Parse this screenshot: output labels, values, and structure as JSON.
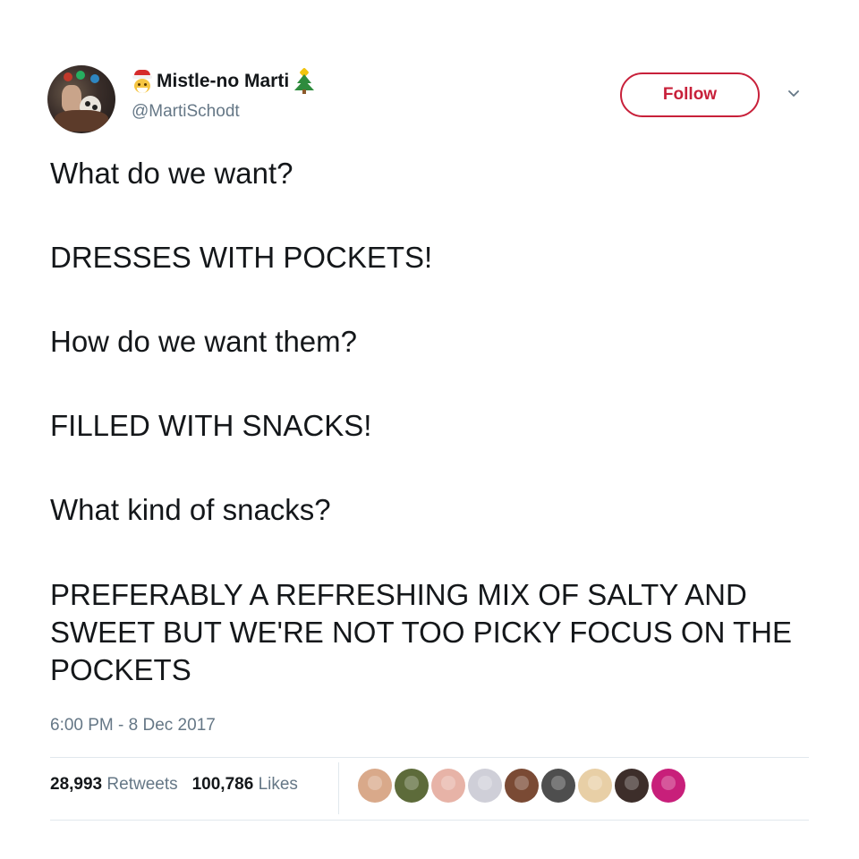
{
  "user": {
    "display_name": "Mistle-no Marti",
    "handle": "@MartiSchodt",
    "avatar_icon": "profile-photo",
    "name_prefix_icon": "santa-emoji",
    "name_suffix_icon": "christmas-tree-emoji"
  },
  "actions": {
    "follow_label": "Follow",
    "menu_icon": "chevron-down-icon"
  },
  "tweet": {
    "lines": [
      "What do we want?",
      "DRESSES WITH POCKETS!",
      "How do we want them?",
      "FILLED WITH SNACKS!",
      "What kind of snacks?",
      "PREFERABLY A REFRESHING MIX OF SALTY AND SWEET BUT WE'RE NOT TOO PICKY FOCUS ON THE POCKETS"
    ],
    "timestamp": "6:00 PM - 8 Dec 2017"
  },
  "stats": {
    "retweets_count": "28,993",
    "retweets_label": "Retweets",
    "likes_count": "100,786",
    "likes_label": "Likes"
  },
  "likers": [
    {
      "color": "#d9a98a"
    },
    {
      "color": "#5d6b3a"
    },
    {
      "color": "#e7b3a7"
    },
    {
      "color": "#cfcfd8"
    },
    {
      "color": "#7a4a34"
    },
    {
      "color": "#4e4e4e"
    },
    {
      "color": "#e8cfa6"
    },
    {
      "color": "#3d2e2a"
    },
    {
      "color": "#c81f7a"
    }
  ],
  "colors": {
    "accent": "#c8203a",
    "secondary_text": "#657786",
    "divider": "#e1e8ed"
  }
}
